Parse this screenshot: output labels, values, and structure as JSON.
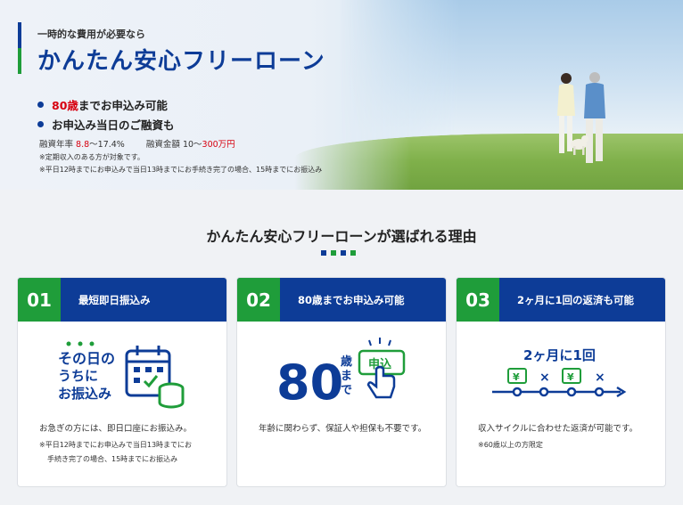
{
  "hero": {
    "subtitle": "一時的な費用が必要なら",
    "title": "かんたん安心フリーローン",
    "bullet1_red": "80歳",
    "bullet1_rest": "までお申込み可能",
    "bullet2": "お申込み当日のご融資も",
    "rate_label": "融資年率",
    "rate_min": "8.8",
    "rate_sep": "～17.4%",
    "amount_label": "融資金額",
    "amount_min": "10～",
    "amount_max": "300万円",
    "note1": "※定期収入のある方が対象です。",
    "note2": "※平日12時までにお申込みで当日13時までにお手続き完了の場合、15時までにお振込み"
  },
  "section": {
    "title": "かんたん安心フリーローンが選ばれる理由"
  },
  "cards": [
    {
      "num": "01",
      "label": "最短即日振込み",
      "illus_text1": "その日の",
      "illus_text2": "うちに",
      "illus_text3": "お振込み",
      "desc": "お急ぎの方には、即日口座にお振込み。",
      "note_line1": "※平日12時までにお申込みで当日13時までにお",
      "note_line2": "手続き完了の場合、15時までにお振込み"
    },
    {
      "num": "02",
      "label": "80歳までお申込み可能",
      "illus_big": "80",
      "illus_side": "歳まで",
      "illus_btn": "申込",
      "desc": "年齢に関わらず、保証人や担保も不要です。"
    },
    {
      "num": "03",
      "label": "2ヶ月に1回の返済も可能",
      "illus_text": "2ヶ月に1回",
      "desc": "収入サイクルに合わせた返済が可能です。",
      "note": "※60歳以上の方限定"
    }
  ],
  "colors": {
    "navy": "#0d3c97",
    "green": "#1f9d3a",
    "red": "#d7000f"
  }
}
